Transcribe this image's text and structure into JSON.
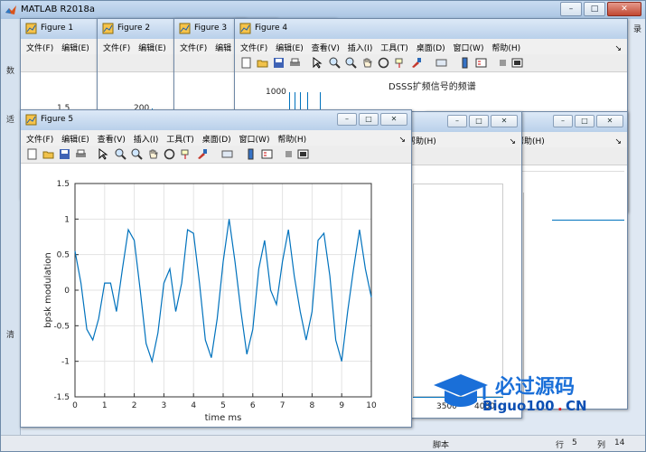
{
  "main_window": {
    "title": "MATLAB R2018a",
    "right_text": "录",
    "left_strip": [
      "数",
      "适",
      "清"
    ],
    "status": {
      "script": "脚本",
      "row_label": "行",
      "row_value": "5",
      "col_label": "列",
      "col_value": "14"
    }
  },
  "menus": {
    "full": [
      "文件(F)",
      "编辑(E)",
      "查看(V)",
      "插入(I)",
      "工具(T)",
      "桌面(D)",
      "窗口(W)",
      "帮助(H)"
    ],
    "help": "帮助(H)"
  },
  "figures": {
    "f1": {
      "title": "Figure 1",
      "ytick": "1.5",
      "menu": [
        "文件(F)",
        "编辑(E)"
      ]
    },
    "f2": {
      "title": "Figure 2",
      "ytick": "200",
      "menu": [
        "文件(F)",
        "编辑(E)"
      ]
    },
    "f3": {
      "title": "Figure 3",
      "menu": [
        "文件(F)",
        "编辑"
      ]
    },
    "f4": {
      "title": "Figure 4",
      "ytick": "1000",
      "plot_title": "DSSS扩频信号的频谱"
    },
    "f6": {
      "xticks": [
        "3500",
        "4000"
      ]
    }
  },
  "watermark": {
    "cn": "必过源码",
    "en": "Biguo100",
    "dot": ".",
    "cn_suffix": "CN"
  },
  "colors": {
    "plot_line": "#0072bd",
    "title_bar": "#b9d0ea",
    "watermark_blue": "#1a6fd8",
    "watermark_red": "#e8141c"
  },
  "chart_data": {
    "type": "line",
    "title": "",
    "xlabel": "time ms",
    "ylabel": "bpsk modulation",
    "xlim": [
      0,
      10
    ],
    "ylim": [
      -1.5,
      1.5
    ],
    "xticks": [
      "0",
      "1",
      "2",
      "3",
      "4",
      "5",
      "6",
      "7",
      "8",
      "9",
      "10"
    ],
    "yticks": [
      "1.5",
      "1",
      "0.5",
      "0",
      "-0.5",
      "-1",
      "-1.5"
    ],
    "grid": true,
    "x": [
      0,
      0.2,
      0.4,
      0.6,
      0.8,
      1.0,
      1.2,
      1.4,
      1.6,
      1.8,
      2.0,
      2.2,
      2.4,
      2.6,
      2.8,
      3.0,
      3.2,
      3.4,
      3.6,
      3.8,
      4.0,
      4.2,
      4.4,
      4.6,
      4.8,
      5.0,
      5.2,
      5.4,
      5.6,
      5.8,
      6.0,
      6.2,
      6.4,
      6.6,
      6.8,
      7.0,
      7.2,
      7.4,
      7.6,
      7.8,
      8.0,
      8.2,
      8.4,
      8.6,
      8.8,
      9.0,
      9.2,
      9.4,
      9.6,
      9.8,
      10.0
    ],
    "y": [
      0.55,
      0.1,
      -0.55,
      -0.7,
      -0.4,
      0.1,
      0.1,
      -0.3,
      0.3,
      0.85,
      0.7,
      0.0,
      -0.75,
      -1.0,
      -0.6,
      0.1,
      0.3,
      -0.3,
      0.1,
      0.85,
      0.8,
      0.1,
      -0.7,
      -0.95,
      -0.4,
      0.4,
      1.0,
      0.4,
      -0.3,
      -0.9,
      -0.55,
      0.3,
      0.7,
      0.0,
      -0.2,
      0.4,
      0.85,
      0.2,
      -0.3,
      -0.7,
      -0.3,
      0.7,
      0.8,
      0.2,
      -0.7,
      -1.0,
      -0.3,
      0.3,
      0.85,
      0.3,
      -0.1
    ]
  }
}
